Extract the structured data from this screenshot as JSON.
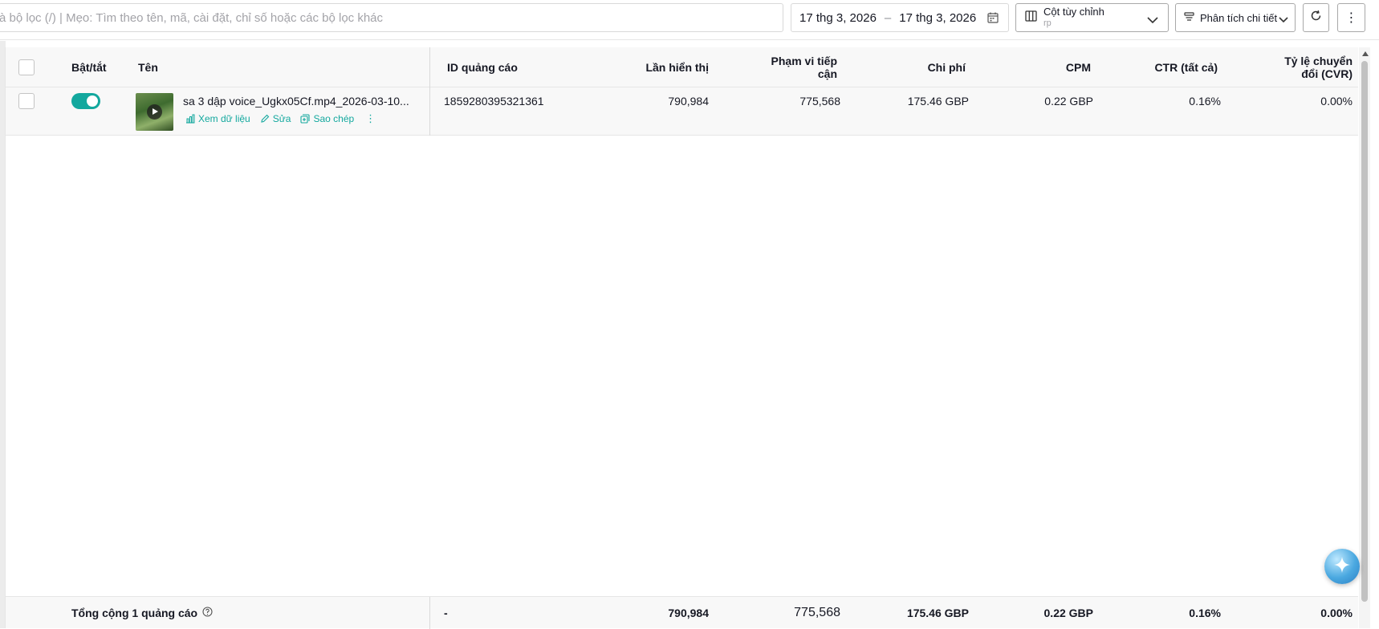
{
  "toolbar": {
    "search_placeholder": "à bộ lọc (/) | Mẹo: Tìm theo tên, mã, cài đặt, chỉ số hoặc các bộ lọc khác",
    "date_start": "17 thg 3, 2026",
    "date_sep": "–",
    "date_end": "17 thg 3, 2026",
    "columns_title": "Cột tùy chỉnh",
    "columns_sub": "rp",
    "breakdown_label": "Phân tích chi tiết",
    "more_label": "⋮"
  },
  "table": {
    "headers": {
      "toggle": "Bật/tắt",
      "name": "Tên",
      "ad_id": "ID quảng cáo",
      "impressions": "Lần hiển thị",
      "reach_line1": "Phạm vi tiếp",
      "reach_line2": "cận",
      "cost": "Chi phí",
      "cpm": "CPM",
      "ctr": "CTR (tất cả)",
      "cvr_line1": "Tỷ lệ chuyển",
      "cvr_line2": "đổi (CVR)"
    },
    "rows": [
      {
        "enabled": true,
        "name": "sa 3 dập voice_Ugkx05Cf.mp4_2026-03-10...",
        "actions": {
          "view": "Xem dữ liệu",
          "edit": "Sửa",
          "copy": "Sao chép",
          "more": "⋮"
        },
        "ad_id": "1859280395321361",
        "impressions": "790,984",
        "reach": "775,568",
        "cost": "175.46 GBP",
        "cpm": "0.22 GBP",
        "ctr": "0.16%",
        "cvr": "0.00%"
      }
    ],
    "footer": {
      "label": "Tổng cộng 1 quảng cáo",
      "ad_id": "-",
      "impressions": "790,984",
      "reach": "775,568",
      "cost": "175.46 GBP",
      "cpm": "0.22 GBP",
      "ctr": "0.16%",
      "cvr": "0.00%"
    }
  },
  "colors": {
    "accent": "#13a89e",
    "header_bg": "#f8f8f8",
    "border": "#e6e6e6"
  }
}
